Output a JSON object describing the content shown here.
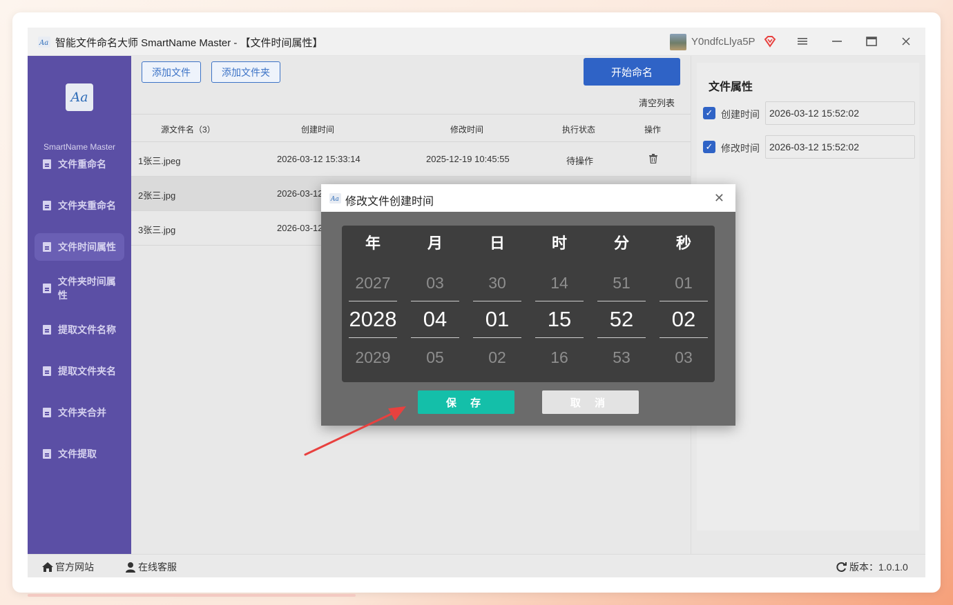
{
  "window": {
    "title": "智能文件命名大师 SmartName Master - 【文件时间属性】",
    "username": "Y0ndfcLlya5P"
  },
  "sidebar": {
    "brand": "SmartName Master",
    "items": [
      {
        "label": "文件重命名"
      },
      {
        "label": "文件夹重命名"
      },
      {
        "label": "文件时间属性"
      },
      {
        "label": "文件夹时间属性"
      },
      {
        "label": "提取文件名称"
      },
      {
        "label": "提取文件夹名"
      },
      {
        "label": "文件夹合并"
      },
      {
        "label": "文件提取"
      }
    ],
    "active_index": 2
  },
  "toolbar": {
    "add_file": "添加文件",
    "add_folder": "添加文件夹",
    "start": "开始命名",
    "clear_list": "清空列表"
  },
  "table": {
    "headers": [
      "源文件名（3）",
      "创建时间",
      "修改时间",
      "执行状态",
      "操作"
    ],
    "rows": [
      {
        "name": "1张三.jpeg",
        "created": "2026-03-12 15:33:14",
        "modified": "2025-12-19 10:45:55",
        "status": "待操作"
      },
      {
        "name": "2张三.jpg",
        "created": "2026-03-12",
        "modified": "",
        "status": ""
      },
      {
        "name": "3张三.jpg",
        "created": "2026-03-12",
        "modified": "",
        "status": ""
      }
    ]
  },
  "attributes": {
    "title": "文件属性",
    "created_label": "创建时间",
    "created_value": "2026-03-12 15:52:02",
    "modified_label": "修改时间",
    "modified_value": "2026-03-12 15:52:02"
  },
  "dialog": {
    "title": "修改文件创建时间",
    "columns": [
      {
        "header": "年",
        "prev": "2027",
        "current": "2028",
        "next": "2029"
      },
      {
        "header": "月",
        "prev": "03",
        "current": "04",
        "next": "05"
      },
      {
        "header": "日",
        "prev": "30",
        "current": "01",
        "next": "02"
      },
      {
        "header": "时",
        "prev": "14",
        "current": "15",
        "next": "16"
      },
      {
        "header": "分",
        "prev": "51",
        "current": "52",
        "next": "53"
      },
      {
        "header": "秒",
        "prev": "01",
        "current": "02",
        "next": "03"
      }
    ],
    "save": "保 存",
    "cancel": "取 消"
  },
  "statusbar": {
    "website": "官方网站",
    "support": "在线客服",
    "version": "版本：1.0.1.0"
  },
  "colors": {
    "sidebar": "#5b4fa5",
    "primary": "#2f63c6",
    "save": "#14bfa9",
    "annotation_arrow": "#e8413f"
  }
}
